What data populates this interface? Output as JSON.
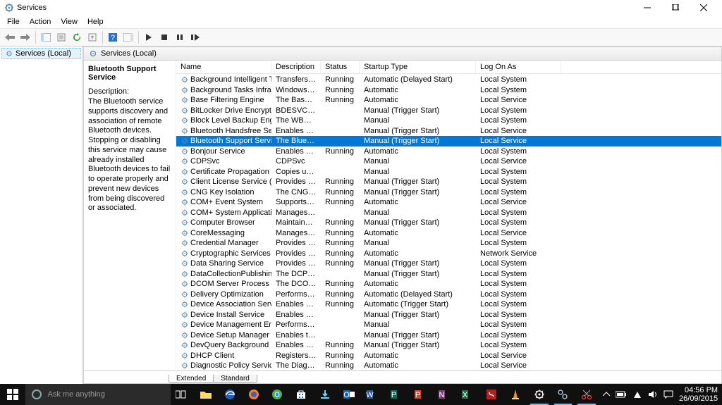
{
  "window": {
    "title": "Services"
  },
  "menu": {
    "file": "File",
    "action": "Action",
    "view": "View",
    "help": "Help"
  },
  "tree": {
    "root": "Services (Local)"
  },
  "header": {
    "label": "Services (Local)"
  },
  "detail": {
    "title": "Bluetooth Support Service",
    "desc_label": "Description:",
    "desc_text": "The Bluetooth service supports discovery and association of remote Bluetooth devices.  Stopping or disabling this service may cause already installed Bluetooth devices to fail to operate properly and prevent new devices from being discovered or associated."
  },
  "columns": {
    "name": "Name",
    "description": "Description",
    "status": "Status",
    "startup": "Startup Type",
    "logon": "Log On As"
  },
  "tabs": {
    "extended": "Extended",
    "standard": "Standard"
  },
  "taskbar": {
    "search_placeholder": "Ask me anything",
    "time": "04:56 PM",
    "date": "26/09/2015"
  },
  "services": [
    {
      "name": "Background Intelligent Tran...",
      "desc": "Transfers fil...",
      "status": "Running",
      "startup": "Automatic (Delayed Start)",
      "logon": "Local System",
      "selected": false
    },
    {
      "name": "Background Tasks Infrastru...",
      "desc": "Windows in...",
      "status": "Running",
      "startup": "Automatic",
      "logon": "Local System",
      "selected": false
    },
    {
      "name": "Base Filtering Engine",
      "desc": "The Base Fil...",
      "status": "Running",
      "startup": "Automatic",
      "logon": "Local Service",
      "selected": false
    },
    {
      "name": "BitLocker Drive Encryption ...",
      "desc": "BDESVC hos...",
      "status": "",
      "startup": "Manual (Trigger Start)",
      "logon": "Local System",
      "selected": false
    },
    {
      "name": "Block Level Backup Engine ...",
      "desc": "The WBENG...",
      "status": "",
      "startup": "Manual",
      "logon": "Local System",
      "selected": false
    },
    {
      "name": "Bluetooth Handsfree Service",
      "desc": "Enables wir...",
      "status": "",
      "startup": "Manual (Trigger Start)",
      "logon": "Local Service",
      "selected": false
    },
    {
      "name": "Bluetooth Support Service",
      "desc": "The Bluetoo...",
      "status": "",
      "startup": "Manual (Trigger Start)",
      "logon": "Local Service",
      "selected": true
    },
    {
      "name": "Bonjour Service",
      "desc": "Enables har...",
      "status": "Running",
      "startup": "Automatic",
      "logon": "Local System",
      "selected": false
    },
    {
      "name": "CDPSvc",
      "desc": "CDPSvc",
      "status": "",
      "startup": "Manual",
      "logon": "Local Service",
      "selected": false
    },
    {
      "name": "Certificate Propagation",
      "desc": "Copies user ...",
      "status": "",
      "startup": "Manual",
      "logon": "Local System",
      "selected": false
    },
    {
      "name": "Client License Service (ClipS...",
      "desc": "Provides inf...",
      "status": "Running",
      "startup": "Manual (Trigger Start)",
      "logon": "Local System",
      "selected": false
    },
    {
      "name": "CNG Key Isolation",
      "desc": "The CNG ke...",
      "status": "Running",
      "startup": "Manual (Trigger Start)",
      "logon": "Local System",
      "selected": false
    },
    {
      "name": "COM+ Event System",
      "desc": "Supports Sy...",
      "status": "Running",
      "startup": "Automatic",
      "logon": "Local Service",
      "selected": false
    },
    {
      "name": "COM+ System Application",
      "desc": "Manages th...",
      "status": "",
      "startup": "Manual",
      "logon": "Local System",
      "selected": false
    },
    {
      "name": "Computer Browser",
      "desc": "Maintains a...",
      "status": "Running",
      "startup": "Manual (Trigger Start)",
      "logon": "Local System",
      "selected": false
    },
    {
      "name": "CoreMessaging",
      "desc": "Manages co...",
      "status": "Running",
      "startup": "Automatic",
      "logon": "Local Service",
      "selected": false
    },
    {
      "name": "Credential Manager",
      "desc": "Provides se...",
      "status": "Running",
      "startup": "Manual",
      "logon": "Local System",
      "selected": false
    },
    {
      "name": "Cryptographic Services",
      "desc": "Provides thr...",
      "status": "Running",
      "startup": "Automatic",
      "logon": "Network Service",
      "selected": false
    },
    {
      "name": "Data Sharing Service",
      "desc": "Provides da...",
      "status": "Running",
      "startup": "Manual (Trigger Start)",
      "logon": "Local System",
      "selected": false
    },
    {
      "name": "DataCollectionPublishingSe...",
      "desc": "The DCP (D...",
      "status": "",
      "startup": "Manual (Trigger Start)",
      "logon": "Local System",
      "selected": false
    },
    {
      "name": "DCOM Server Process Laun...",
      "desc": "The DCOM...",
      "status": "Running",
      "startup": "Automatic",
      "logon": "Local System",
      "selected": false
    },
    {
      "name": "Delivery Optimization",
      "desc": "Performs co...",
      "status": "Running",
      "startup": "Automatic (Delayed Start)",
      "logon": "Local System",
      "selected": false
    },
    {
      "name": "Device Association Service",
      "desc": "Enables pair...",
      "status": "Running",
      "startup": "Automatic (Trigger Start)",
      "logon": "Local System",
      "selected": false
    },
    {
      "name": "Device Install Service",
      "desc": "Enables a c...",
      "status": "",
      "startup": "Manual (Trigger Start)",
      "logon": "Local System",
      "selected": false
    },
    {
      "name": "Device Management Enroll...",
      "desc": "Performs D...",
      "status": "",
      "startup": "Manual",
      "logon": "Local System",
      "selected": false
    },
    {
      "name": "Device Setup Manager",
      "desc": "Enables the ...",
      "status": "",
      "startup": "Manual (Trigger Start)",
      "logon": "Local System",
      "selected": false
    },
    {
      "name": "DevQuery Background Disc...",
      "desc": "Enables app...",
      "status": "Running",
      "startup": "Manual (Trigger Start)",
      "logon": "Local System",
      "selected": false
    },
    {
      "name": "DHCP Client",
      "desc": "Registers an...",
      "status": "Running",
      "startup": "Automatic",
      "logon": "Local Service",
      "selected": false
    },
    {
      "name": "Diagnostic Policy Service",
      "desc": "The Diagno...",
      "status": "Running",
      "startup": "Automatic",
      "logon": "Local Service",
      "selected": false
    }
  ]
}
